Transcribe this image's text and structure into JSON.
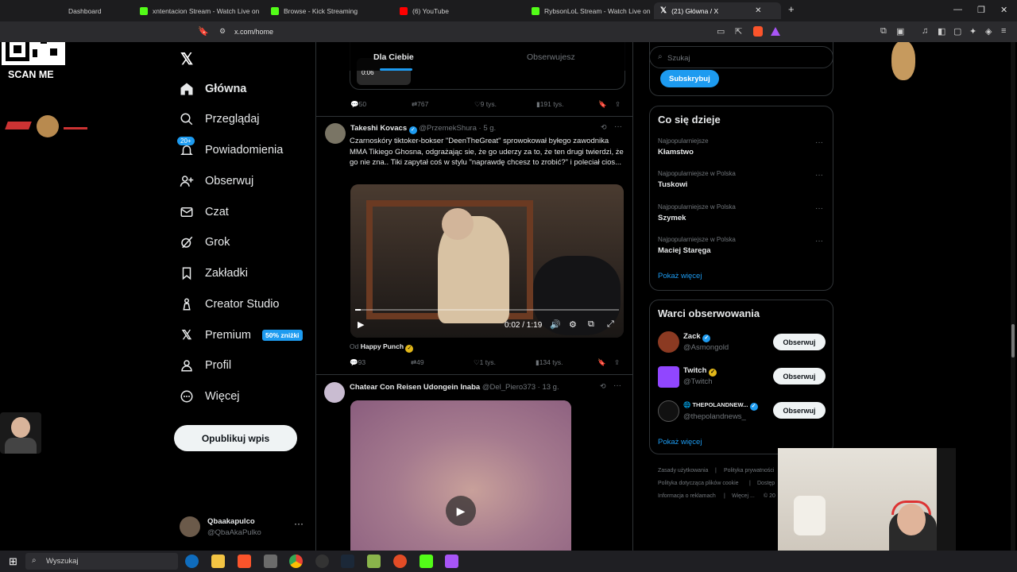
{
  "browser": {
    "tabs": [
      {
        "label": "Dashboard",
        "color": "#7b6cff"
      },
      {
        "label": "xntentacion Stream - Watch Live on K",
        "color": "#53fc18"
      },
      {
        "label": "Browse - Kick Streaming",
        "color": "#53fc18"
      },
      {
        "label": "(6) YouTube",
        "color": "#ff0000"
      },
      {
        "label": "RybsonLoL Stream - Watch Live on K",
        "color": "#53fc18"
      },
      {
        "label": "(21) Główna / X",
        "color": "#000000"
      }
    ],
    "url": "x.com/home"
  },
  "overlay": {
    "qr_label": "SCAN ME"
  },
  "nav": {
    "items": [
      {
        "label": "Główna",
        "icon": "home-icon"
      },
      {
        "label": "Przeglądaj",
        "icon": "search-icon"
      },
      {
        "label": "Powiadomienia",
        "icon": "bell-icon",
        "badge": "20+"
      },
      {
        "label": "Obserwuj",
        "icon": "add-user-icon"
      },
      {
        "label": "Czat",
        "icon": "mail-icon"
      },
      {
        "label": "Grok",
        "icon": "grok-icon"
      },
      {
        "label": "Zakładki",
        "icon": "bookmark-icon"
      },
      {
        "label": "Creator Studio",
        "icon": "creator-icon"
      },
      {
        "label": "Premium",
        "icon": "x-logo-icon",
        "badge": "50% zniżki"
      },
      {
        "label": "Profil",
        "icon": "person-icon"
      },
      {
        "label": "Więcej",
        "icon": "more-circle-icon"
      }
    ],
    "post_button": "Opublikuj wpis",
    "profile": {
      "name": "Qbaakapulco",
      "handle": "@QbaAkaPulko"
    }
  },
  "feed": {
    "tabs": [
      "Dla Ciebie",
      "Obserwujesz"
    ],
    "top_tweet": {
      "video_time": "0:06",
      "replies": "50",
      "reposts": "767",
      "likes": "9 tys.",
      "views": "191 tys."
    },
    "tweet1": {
      "name": "Takeshi Kovacs",
      "handle": "@PrzemekShura",
      "time": "· 5 g.",
      "text": "Czarnoskóry tiktoker-bokser \"DeenTheGreat\" sprowokował byłego zawodnika MMA Tikiego Ghosna, odgrażając sie, że go uderzy za to, że ten drugi twierdzi, że go nie zna.. Tiki zapytał coś w stylu \"naprawdę chcesz to zrobić?\" i poleciał cios...",
      "video_time": "0:02 / 1:19",
      "video_progress": 0.02,
      "from_label": "Od",
      "from_name": "Happy Punch",
      "replies": "93",
      "reposts": "49",
      "likes": "1 tys.",
      "views": "134 tys."
    },
    "tweet2": {
      "name": "Chatear Con Reisen Udongein Inaba",
      "handle": "@Del_Piero373",
      "time": "· 13 g."
    }
  },
  "sidebar": {
    "search_placeholder": "Szukaj",
    "subscribe": "Subskrybuj",
    "trends_title": "Co się dzieje",
    "trends": [
      {
        "category": "Najpopularniejsze",
        "name": "Kłamstwo"
      },
      {
        "category": "Najpopularniejsze w Polska",
        "name": "Tuskowi"
      },
      {
        "category": "Najpopularniejsze w Polska",
        "name": "Szymek"
      },
      {
        "category": "Najpopularniejsze w Polska",
        "name": "Maciej Staręga"
      }
    ],
    "show_more": "Pokaż więcej",
    "who_to_follow_title": "Warci obserwowania",
    "who_to_follow": [
      {
        "name": "Zack",
        "handle": "@Asmongold",
        "button": "Obserwuj",
        "badge": "blue"
      },
      {
        "name": "Twitch",
        "handle": "@Twitch",
        "button": "Obserwuj",
        "badge": "gold"
      },
      {
        "name": "THEPOLANDNEW...",
        "handle": "@thepolandnews_",
        "button": "Obserwuj",
        "badge": "blue"
      }
    ],
    "show_more2": "Pokaż więcej",
    "footer": [
      "Zasady użytkowania",
      "|",
      "Polityka prywatności",
      "Polityka dotycząca plików cookie",
      "|",
      "Dostęp",
      "Informacja o reklamach",
      "|",
      "Więcej ...",
      "© 20"
    ]
  },
  "taskbar": {
    "search": "Wyszukaj"
  }
}
